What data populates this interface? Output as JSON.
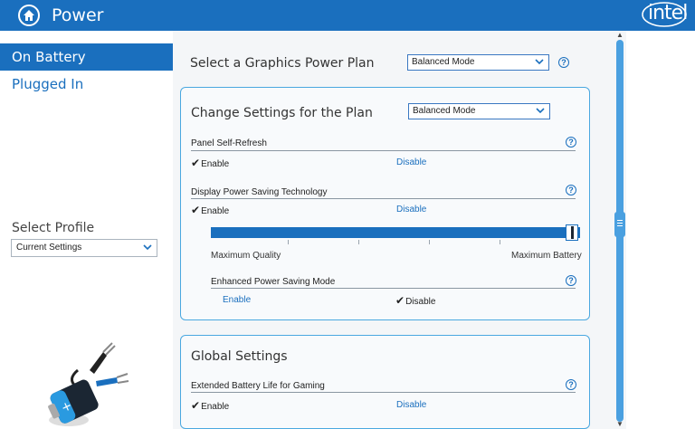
{
  "header": {
    "title": "Power",
    "brand": "intel"
  },
  "sidebar": {
    "items": [
      {
        "label": "On Battery",
        "active": true
      },
      {
        "label": "Plugged In",
        "active": false
      }
    ],
    "profile_label": "Select Profile",
    "profile_value": "Current Settings"
  },
  "main": {
    "plan_label": "Select a Graphics Power Plan",
    "plan_value": "Balanced Mode",
    "plan_card": {
      "title": "Change Settings for the Plan",
      "mode_value": "Balanced Mode",
      "panel_self_refresh": {
        "label": "Panel Self-Refresh",
        "enable": "Enable",
        "disable": "Disable"
      },
      "dpst": {
        "label": "Display Power Saving Technology",
        "enable": "Enable",
        "disable": "Disable",
        "level": 1.0
      },
      "slider": {
        "min_label": "Maximum Quality",
        "max_label": "Maximum Battery"
      },
      "epsm": {
        "label": "Enhanced Power Saving Mode",
        "enable": "Enable",
        "disable": "Disable"
      }
    },
    "global_card": {
      "title": "Global Settings",
      "eblg": {
        "label": "Extended Battery Life for Gaming",
        "enable": "Enable",
        "disable": "Disable"
      }
    }
  },
  "icons": {
    "help": "?",
    "check": "✔"
  },
  "colors": {
    "accent": "#1a6fbe",
    "card_border": "#4aa8e0"
  }
}
